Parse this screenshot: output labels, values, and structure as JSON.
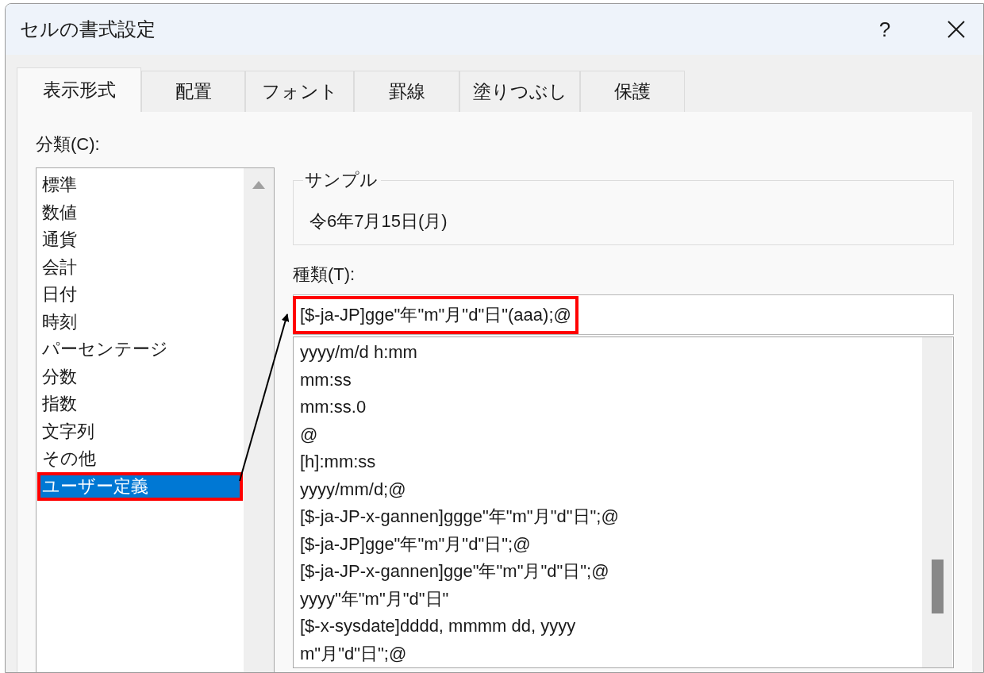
{
  "window": {
    "title": "セルの書式設定",
    "help_button": "?"
  },
  "tabs": [
    {
      "label": "表示形式",
      "selected": true
    },
    {
      "label": "配置",
      "selected": false
    },
    {
      "label": "フォント",
      "selected": false
    },
    {
      "label": "罫線",
      "selected": false
    },
    {
      "label": "塗りつぶし",
      "selected": false
    },
    {
      "label": "保護",
      "selected": false
    }
  ],
  "category": {
    "label": "分類(C):",
    "items": [
      {
        "label": "標準",
        "selected": false,
        "highlighted": false
      },
      {
        "label": "数値",
        "selected": false,
        "highlighted": false
      },
      {
        "label": "通貨",
        "selected": false,
        "highlighted": false
      },
      {
        "label": "会計",
        "selected": false,
        "highlighted": false
      },
      {
        "label": "日付",
        "selected": false,
        "highlighted": false
      },
      {
        "label": "時刻",
        "selected": false,
        "highlighted": false
      },
      {
        "label": "パーセンテージ",
        "selected": false,
        "highlighted": false
      },
      {
        "label": "分数",
        "selected": false,
        "highlighted": false
      },
      {
        "label": "指数",
        "selected": false,
        "highlighted": false
      },
      {
        "label": "文字列",
        "selected": false,
        "highlighted": false
      },
      {
        "label": "その他",
        "selected": false,
        "highlighted": false
      },
      {
        "label": "ユーザー定義",
        "selected": true,
        "highlighted": true
      }
    ]
  },
  "sample": {
    "label": "サンプル",
    "value": "令6年7月15日(月)"
  },
  "type": {
    "label": "種類(T):",
    "value": "[$-ja-JP]gge\"年\"m\"月\"d\"日\"(aaa);@",
    "highlighted": true,
    "items": [
      "yyyy/m/d h:mm",
      "mm:ss",
      "mm:ss.0",
      "@",
      "[h]:mm:ss",
      "yyyy/mm/d;@",
      "[$-ja-JP-x-gannen]ggge\"年\"m\"月\"d\"日\";@",
      "[$-ja-JP]gge\"年\"m\"月\"d\"日\";@",
      "[$-ja-JP-x-gannen]gge\"年\"m\"月\"d\"日\";@",
      "yyyy\"年\"m\"月\"d\"日\"",
      "[$-x-sysdate]dddd, mmmm dd, yyyy",
      "m\"月\"d\"日\";@"
    ]
  }
}
